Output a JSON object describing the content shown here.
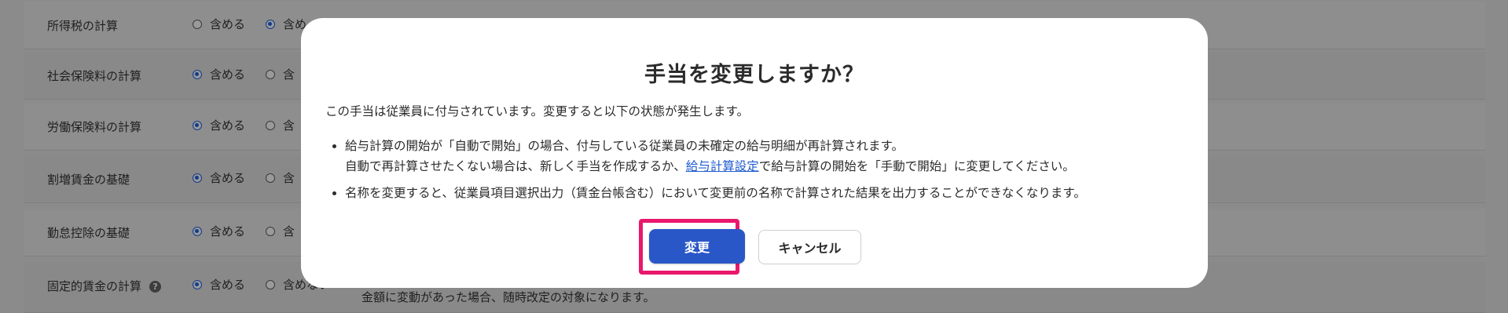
{
  "background": {
    "rows": [
      {
        "label": "所得税の計算",
        "selected": 2,
        "opt1": "含める",
        "opt2": "含め"
      },
      {
        "label": "社会保険料の計算",
        "selected": 1,
        "opt1": "含める",
        "opt2": "含"
      },
      {
        "label": "労働保険料の計算",
        "selected": 1,
        "opt1": "含める",
        "opt2": "含"
      },
      {
        "label": "割増賃金の基礎",
        "selected": 1,
        "opt1": "含める",
        "opt2": "含"
      },
      {
        "label": "勤怠控除の基礎",
        "selected": 1,
        "opt1": "含める",
        "opt2": "含"
      },
      {
        "label": "固定的賃金の計算",
        "selected": 1,
        "opt1": "含める",
        "opt2": "含めない",
        "help": "?"
      }
    ],
    "note": "金額に変動があった場合、随時改定の対象になります。"
  },
  "modal": {
    "title": "手当を変更しますか？",
    "intro": "この手当は従業員に付与されています。変更すると以下の状態が発生します。",
    "bullet1_line1": "給与計算の開始が「自動で開始」の場合、付与している従業員の未確定の給与明細が再計算されます。",
    "bullet1_line2_before": "自動で再計算させたくない場合は、新しく手当を作成するか、",
    "bullet1_link": "給与計算設定",
    "bullet1_line2_after": "で給与計算の開始を「手動で開始」に変更してください。",
    "bullet2": "名称を変更すると、従業員項目選択出力（賃金台帳含む）において変更前の名称で計算された結果を出力することができなくなります。",
    "confirm_label": "変更",
    "cancel_label": "キャンセル"
  },
  "colors": {
    "primary": "#2a57c7",
    "highlight": "#e8186c",
    "link": "#1f5bd1",
    "overlay": "#8b8b8b"
  }
}
